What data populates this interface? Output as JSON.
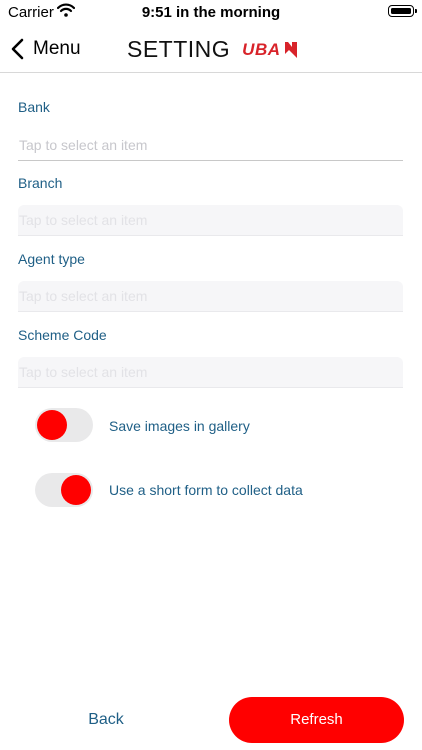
{
  "status_bar": {
    "carrier": "Carrier",
    "time": "9:51 in the morning",
    "wifi_icon": "wifi-icon",
    "battery_icon": "battery-icon"
  },
  "nav": {
    "back_label": "Menu",
    "back_icon": "chevron-left-icon",
    "title": "SETTING",
    "logo_text": "UBA"
  },
  "form": {
    "bank": {
      "label": "Bank",
      "placeholder": "Tap to select an item",
      "enabled": true
    },
    "branch": {
      "label": "Branch",
      "placeholder": "Tap to select an item",
      "enabled": false
    },
    "agent_type": {
      "label": "Agent type",
      "placeholder": "Tap to select an item",
      "enabled": false
    },
    "scheme_code": {
      "label": "Scheme Code",
      "placeholder": "Tap to select an item",
      "enabled": false
    }
  },
  "toggles": {
    "save_images": {
      "label": "Save images in gallery",
      "on": false
    },
    "short_form": {
      "label": "Use a short form to collect data",
      "on": true
    }
  },
  "footer": {
    "back_label": "Back",
    "refresh_label": "Refresh"
  },
  "colors": {
    "accent": "#ff0000",
    "label_text": "#1f5f86",
    "logo_red": "#d8232a"
  }
}
